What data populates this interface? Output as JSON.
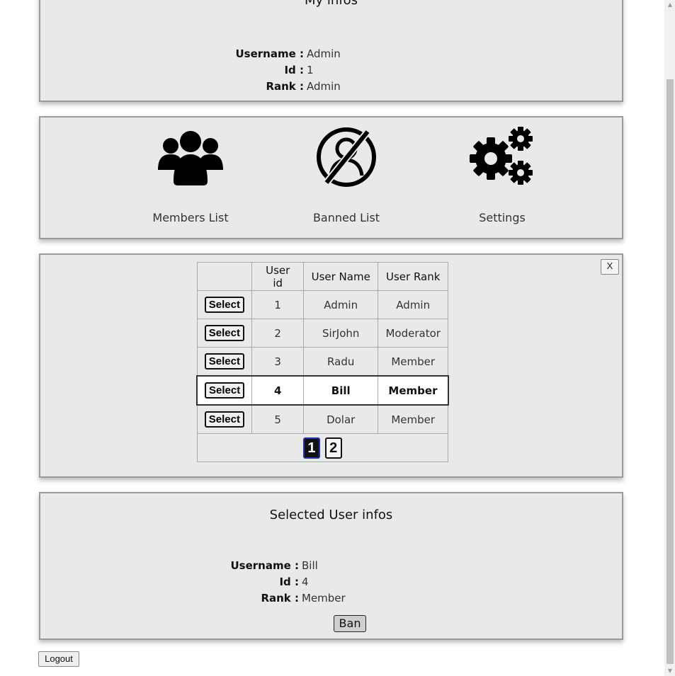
{
  "my_infos": {
    "title": "My infos",
    "rows": [
      {
        "label": "Username :",
        "value": "Admin"
      },
      {
        "label": "Id :",
        "value": "1"
      },
      {
        "label": "Rank :",
        "value": "Admin"
      }
    ]
  },
  "menu": {
    "items": [
      {
        "label": "Members List",
        "icon": "users-icon"
      },
      {
        "label": "Banned List",
        "icon": "banned-user-icon"
      },
      {
        "label": "Settings",
        "icon": "gears-icon"
      }
    ]
  },
  "members_table": {
    "close_label": "X",
    "columns": [
      "",
      "User id",
      "User Name",
      "User Rank"
    ],
    "select_label": "Select",
    "rows": [
      {
        "id": "1",
        "name": "Admin",
        "rank": "Admin"
      },
      {
        "id": "2",
        "name": "SirJohn",
        "rank": "Moderator"
      },
      {
        "id": "3",
        "name": "Radu",
        "rank": "Member"
      },
      {
        "id": "4",
        "name": "Bill",
        "rank": "Member"
      },
      {
        "id": "5",
        "name": "Dolar",
        "rank": "Member"
      }
    ],
    "highlighted_row": 4,
    "pages": [
      "1",
      "2"
    ],
    "current_page": "1"
  },
  "selected_user": {
    "title": "Selected User infos",
    "rows": [
      {
        "label": "Username :",
        "value": "Bill"
      },
      {
        "label": "Id :",
        "value": "4"
      },
      {
        "label": "Rank :",
        "value": "Member"
      }
    ],
    "ban_label": "Ban"
  },
  "logout_label": "Logout"
}
